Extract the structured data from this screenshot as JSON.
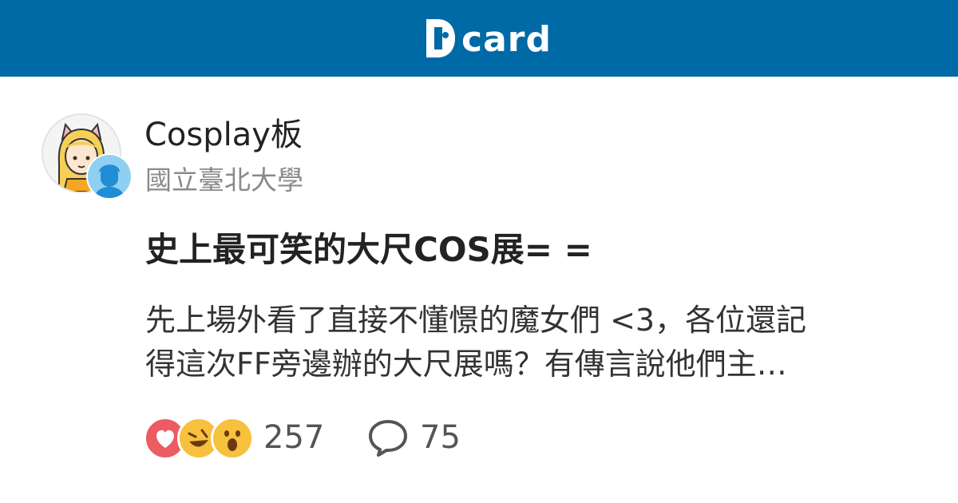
{
  "header": {
    "logo_text": "card",
    "logo_icon": "dcard-logo-icon",
    "background_color": "#006aa6"
  },
  "post": {
    "forum": "Cosplay板",
    "school": "國立臺北大學",
    "title": "史上最可笑的大尺COS展= =",
    "excerpt_lines": [
      "先上場外看了直接不懂憬的魔女們 <3，各位還記",
      "得這次FF旁邊辦的大尺展嗎？有傳言說他們主…"
    ],
    "avatar_icon": "cat-girl-avatar-icon",
    "author_badge_icon": "anonymous-male-avatar-icon"
  },
  "stats": {
    "reactions": [
      "heart-icon",
      "laugh-icon",
      "wow-icon"
    ],
    "like_count": "257",
    "comment_icon": "speech-bubble-icon",
    "comment_count": "75"
  },
  "colors": {
    "brand": "#006aa6",
    "heart": "#ec5c63",
    "emoji": "#f7c13d",
    "badge": "#8fd0f2"
  }
}
